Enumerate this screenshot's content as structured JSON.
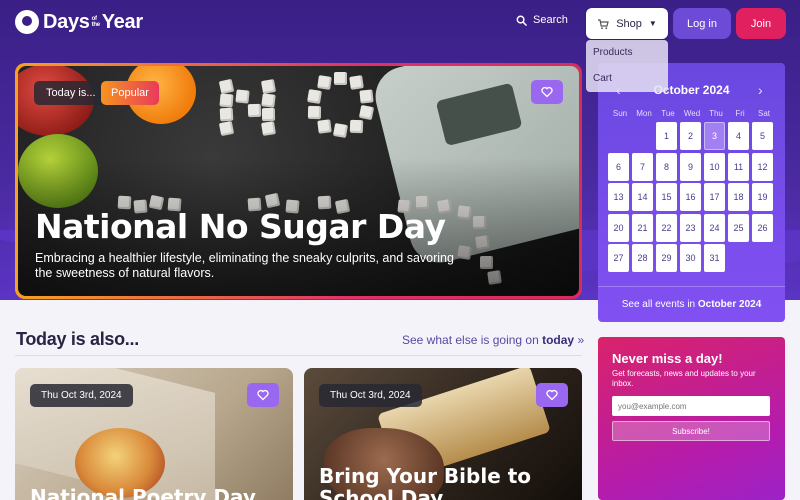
{
  "header": {
    "logo_days": "Days",
    "logo_of": "of",
    "logo_the": "the",
    "logo_year": "Year",
    "search_label": "Search",
    "shop_label": "Shop",
    "login_label": "Log in",
    "join_label": "Join"
  },
  "shop_menu": {
    "items": [
      "Products",
      "Cart"
    ]
  },
  "hero": {
    "badge_today": "Today is...",
    "badge_popular": "Popular",
    "title": "National No Sugar Day",
    "description": "Embracing a healthier lifestyle, eliminating the sneaky culprits, and savoring the sweetness of natural flavors."
  },
  "calendar": {
    "month": "October 2024",
    "weekdays": [
      "Sun",
      "Mon",
      "Tue",
      "Wed",
      "Thu",
      "Fri",
      "Sat"
    ],
    "first_weekday_index": 2,
    "days_in_month": 31,
    "today": 3,
    "footer_prefix": "See all events in ",
    "footer_month": "October 2024"
  },
  "today_also": {
    "title": "Today is also...",
    "link_prefix": "See what else is going on ",
    "link_bold": "today",
    "link_arrow": "»",
    "cards": [
      {
        "date": "Thu Oct 3rd, 2024",
        "title": "National Poetry Day"
      },
      {
        "date": "Thu Oct 3rd, 2024",
        "title": "Bring Your Bible to School Day"
      }
    ]
  },
  "newsletter": {
    "title": "Never miss a day!",
    "description": "Get forecasts, news and updates to your inbox.",
    "email_placeholder": "you@example.com",
    "subscribe_label": "Subscribe!"
  },
  "colors": {
    "brand_purple": "#3a1f86",
    "accent_pink": "#e0205f",
    "calendar_purple": "#7a4cec"
  }
}
